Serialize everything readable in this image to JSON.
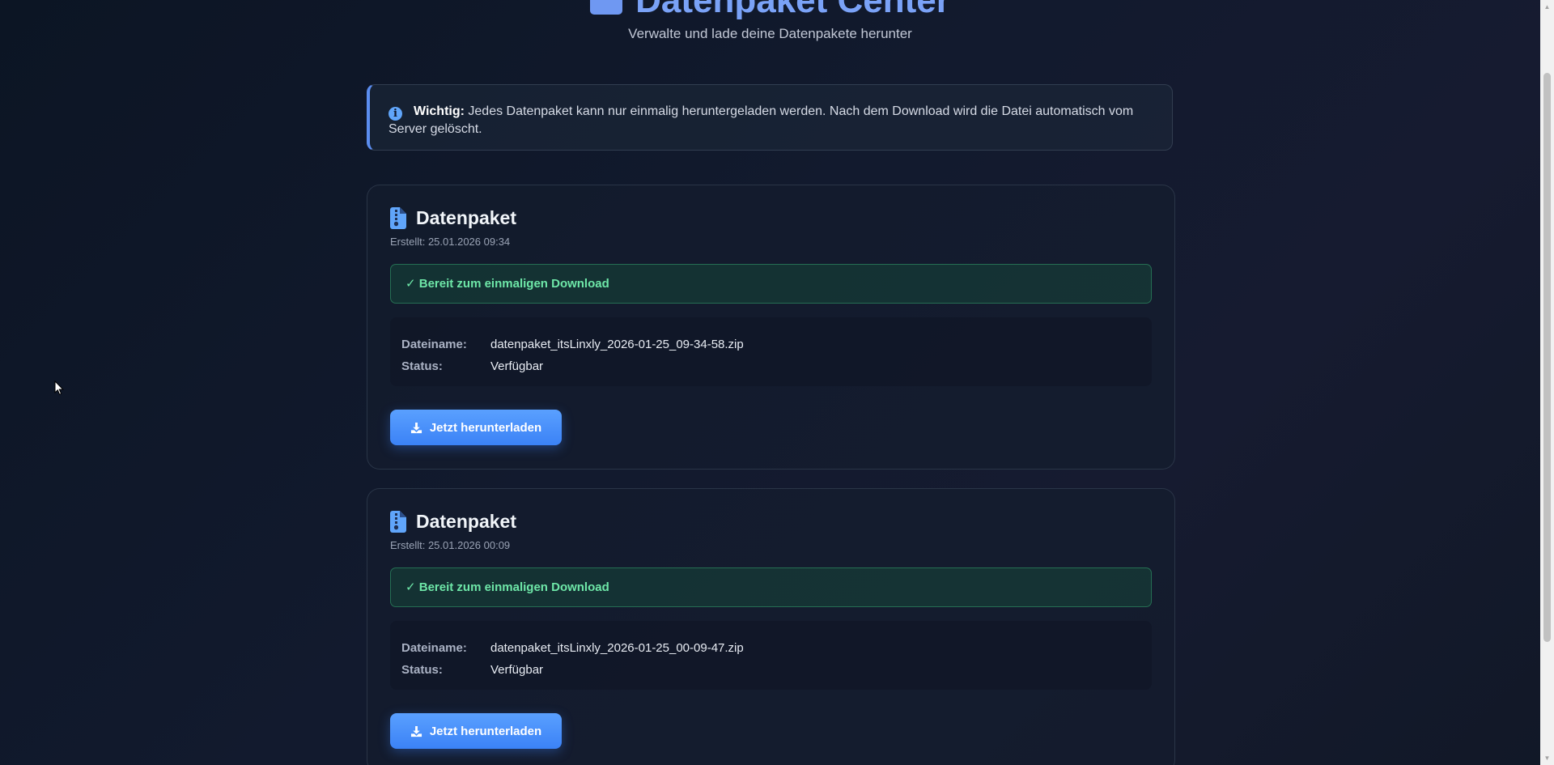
{
  "header": {
    "title": "Datenpaket Center",
    "subtitle": "Verwalte und lade deine Datenpakete herunter"
  },
  "notice": {
    "bold": "Wichtig:",
    "text": " Jedes Datenpaket kann nur einmalig heruntergeladen werden. Nach dem Download wird die Datei automatisch vom Server gelöscht."
  },
  "cards": [
    {
      "title": "Datenpaket",
      "created": "Erstellt: 25.01.2026 09:34",
      "badge": "✓ Bereit zum einmaligen Download",
      "filename_label": "Dateiname:",
      "filename": "datenpaket_itsLinxly_2026-01-25_09-34-58.zip",
      "status_label": "Status:",
      "status": "Verfügbar",
      "button": "Jetzt herunterladen"
    },
    {
      "title": "Datenpaket",
      "created": "Erstellt: 25.01.2026 00:09",
      "badge": "✓ Bereit zum einmaligen Download",
      "filename_label": "Dateiname:",
      "filename": "datenpaket_itsLinxly_2026-01-25_00-09-47.zip",
      "status_label": "Status:",
      "status": "Verfügbar",
      "button": "Jetzt herunterladen"
    }
  ],
  "icons": {
    "header": "folder-icon",
    "notice": "info-icon",
    "card": "file-zipper-icon",
    "button": "download-icon"
  },
  "colors": {
    "accent": "#7aa2f7",
    "button": "#3b82f6",
    "success_text": "#6ee7a8"
  }
}
